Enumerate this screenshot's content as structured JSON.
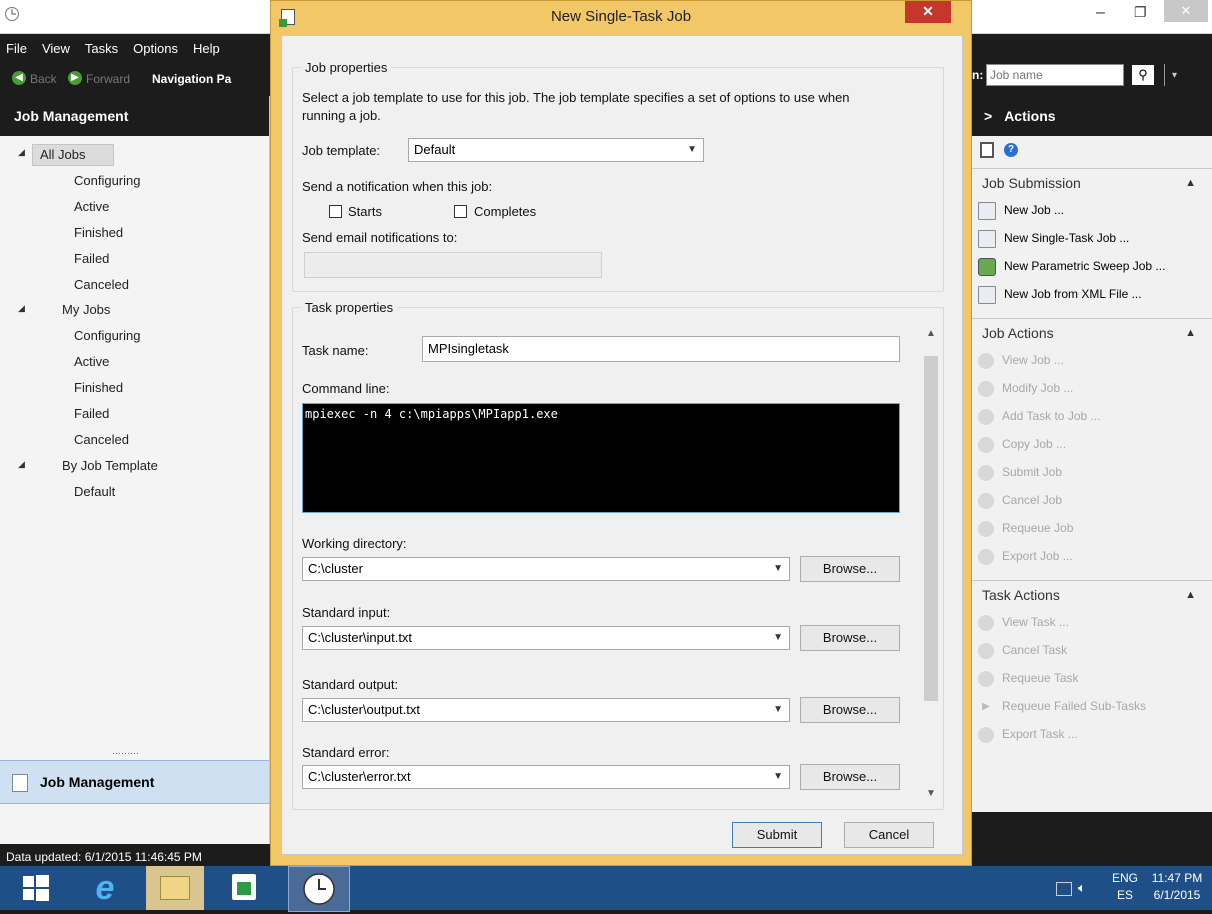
{
  "dialog": {
    "title": "New Single-Task Job",
    "job_group": "Job properties",
    "job_desc_line1": "Select a job template to use for this job. The job template specifies a set of options to use when",
    "job_desc_line2": "running a job.",
    "template_label": "Job template:",
    "template_value": "Default",
    "notify_label": "Send a notification when this job:",
    "starts_label": "Starts",
    "completes_label": "Completes",
    "email_label": "Send email notifications to:",
    "email_value": "",
    "task_group": "Task properties",
    "task_name_label": "Task name:",
    "task_name_value": "MPIsingletask",
    "cmd_label": "Command line:",
    "cmd_value": "mpiexec -n 4 c:\\mpiapps\\MPIapp1.exe",
    "workdir_label": "Working directory:",
    "workdir_value": "C:\\cluster",
    "stdin_label": "Standard input:",
    "stdin_value": "C:\\cluster\\input.txt",
    "stdout_label": "Standard output:",
    "stdout_value": "C:\\cluster\\output.txt",
    "stderr_label": "Standard error:",
    "stderr_value": "C:\\cluster\\error.txt",
    "browse_label": "Browse...",
    "submit_label": "Submit",
    "cancel_label": "Cancel"
  },
  "menu": [
    "File",
    "View",
    "Tasks",
    "Options",
    "Help"
  ],
  "nav": {
    "back": "Back",
    "forward": "Forward",
    "navpane": "Navigation Pa"
  },
  "left": {
    "header": "Job Management",
    "tree": [
      {
        "label": "All Jobs"
      },
      {
        "label": "Configuring"
      },
      {
        "label": "Active"
      },
      {
        "label": "Finished"
      },
      {
        "label": "Failed"
      },
      {
        "label": "Canceled"
      },
      {
        "label": "My Jobs"
      },
      {
        "label": "Configuring"
      },
      {
        "label": "Active"
      },
      {
        "label": "Finished"
      },
      {
        "label": "Failed"
      },
      {
        "label": "Canceled"
      },
      {
        "label": "By Job Template"
      },
      {
        "label": "Default"
      }
    ],
    "bottom_tab": "Job Management",
    "status": "Data updated: 6/1/2015 11:46:45 PM"
  },
  "right": {
    "search_prefix": "n:",
    "search_placeholder": "Job name",
    "actions_header": "Actions",
    "job_submission": "Job Submission",
    "submission_items": [
      "New Job ...",
      "New Single-Task Job ...",
      "New Parametric Sweep Job ...",
      "New Job from XML File ..."
    ],
    "job_actions": "Job Actions",
    "job_action_items": [
      "View Job ...",
      "Modify Job ...",
      "Add Task to Job ...",
      "Copy Job ...",
      "Submit Job",
      "Cancel Job",
      "Requeue Job",
      "Export Job ..."
    ],
    "task_actions": "Task Actions",
    "task_action_items": [
      "View Task ...",
      "Cancel Task",
      "Requeue Task",
      "Requeue Failed Sub-Tasks",
      "Export Task ..."
    ]
  },
  "taskbar": {
    "lang1": "ENG",
    "lang2": "ES",
    "time": "11:47 PM",
    "date": "6/1/2015"
  },
  "colors": {
    "dialog_frame": "#f1c768",
    "close_button": "#c6362c",
    "taskbar": "#1e4f86",
    "dark_chrome": "#1c1c1c"
  }
}
